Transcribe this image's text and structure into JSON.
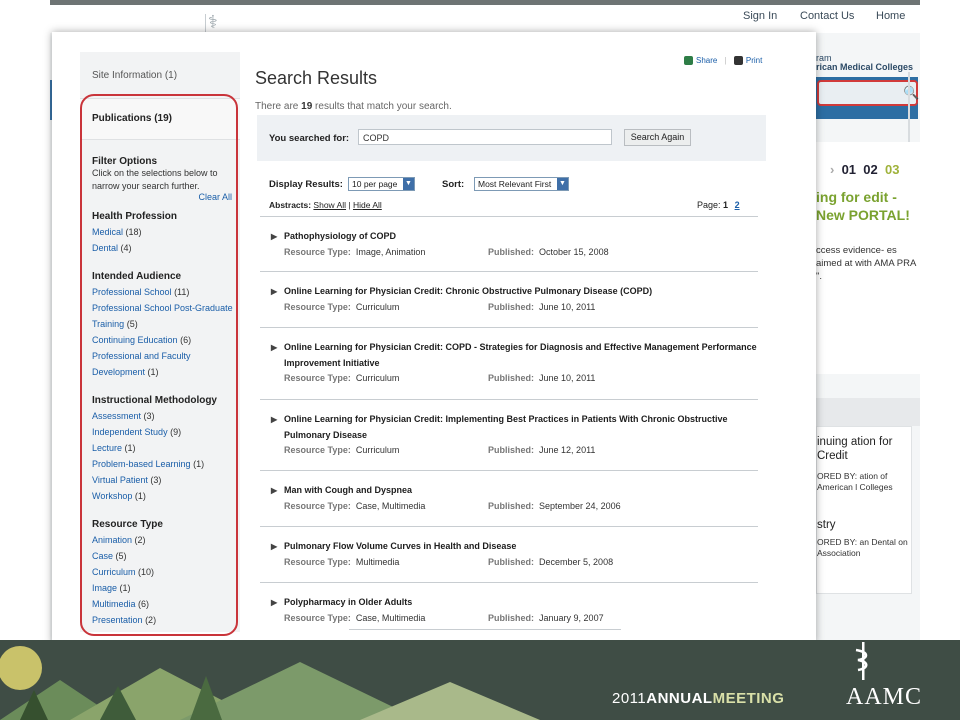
{
  "background_site": {
    "nav": {
      "signin": "Sign In",
      "contact": "Contact Us",
      "home": "Home"
    },
    "brand_lines": [
      "ram",
      "rican Medical Colleges"
    ],
    "promo": {
      "pager": [
        "01",
        "02",
        "03"
      ],
      "headline": "ing for edit - New PORTAL!",
      "text": "ccess evidence- es aimed at with AMA PRA \"."
    },
    "card": {
      "item1": "inuing ation for Credit",
      "item1_sponsor": "ORED BY: ation of American l Colleges",
      "item2": "stry",
      "item2_sponsor": "ORED BY: an Dental on Association"
    }
  },
  "actions": {
    "share": "Share",
    "print": "Print"
  },
  "sidebar": {
    "site_information": "Site Information (1)",
    "publications": "Publications (19)",
    "filter_heading": "Filter Options",
    "filter_text": "Click on the selections below to narrow your search further.",
    "clear_all": "Clear All",
    "sections": [
      {
        "heading": "Health Profession",
        "items": [
          {
            "label": "Medical",
            "count": "(18)"
          },
          {
            "label": "Dental",
            "count": "(4)"
          }
        ]
      },
      {
        "heading": "Intended Audience",
        "items": [
          {
            "label": "Professional School",
            "count": "(11)"
          },
          {
            "label": "Professional School Post-Graduate",
            "count": ""
          },
          {
            "label": "Training",
            "count": "(5)"
          },
          {
            "label": "Continuing Education",
            "count": "(6)"
          },
          {
            "label": "Professional and Faculty",
            "count": ""
          },
          {
            "label": "Development",
            "count": "(1)"
          }
        ]
      },
      {
        "heading": "Instructional Methodology",
        "items": [
          {
            "label": "Assessment",
            "count": "(3)"
          },
          {
            "label": "Independent Study",
            "count": "(9)"
          },
          {
            "label": "Lecture",
            "count": "(1)"
          },
          {
            "label": "Problem-based Learning",
            "count": "(1)"
          },
          {
            "label": "Virtual Patient",
            "count": "(3)"
          },
          {
            "label": "Workshop",
            "count": "(1)"
          }
        ]
      },
      {
        "heading": "Resource Type",
        "items": [
          {
            "label": "Animation",
            "count": "(2)"
          },
          {
            "label": "Case",
            "count": "(5)"
          },
          {
            "label": "Curriculum",
            "count": "(10)"
          },
          {
            "label": "Image",
            "count": "(1)"
          },
          {
            "label": "Multimedia",
            "count": "(6)"
          },
          {
            "label": "Presentation",
            "count": "(2)"
          }
        ]
      }
    ]
  },
  "main": {
    "title": "Search Results",
    "count_prefix": "There are",
    "count": "19",
    "count_suffix": "results that match your search.",
    "search": {
      "label": "You searched for:",
      "value": "COPD",
      "button": "Search Again"
    },
    "display_label": "Display Results:",
    "display_value": "10 per page",
    "sort_label": "Sort:",
    "sort_value": "Most Relevant First",
    "abstracts_label": "Abstracts:",
    "show_all": "Show All",
    "hide_all": "Hide All",
    "page_label": "Page:",
    "page_current": "1",
    "page_next": "2",
    "type_label": "Resource Type:",
    "published_label": "Published:",
    "results": [
      {
        "title": "Pathophysiology of COPD",
        "type": "Image, Animation",
        "published": "October 15, 2008"
      },
      {
        "title": "Online Learning for Physician Credit: Chronic Obstructive Pulmonary Disease (COPD)",
        "type": "Curriculum",
        "published": "June 10, 2011"
      },
      {
        "title": "Online Learning for Physician Credit: COPD - Strategies for Diagnosis and Effective Management Performance Improvement Initiative",
        "type": "Curriculum",
        "published": "June 10, 2011"
      },
      {
        "title": "Online Learning for Physician Credit: Implementing Best Practices in Patients With Chronic Obstructive Pulmonary Disease",
        "type": "Curriculum",
        "published": "June 12, 2011"
      },
      {
        "title": "Man with Cough and Dyspnea",
        "type": "Case, Multimedia",
        "published": "September 24, 2006"
      },
      {
        "title": "Pulmonary Flow Volume Curves in Health and Disease",
        "type": "Multimedia",
        "published": "December 5, 2008"
      },
      {
        "title": "Polypharmacy in Older Adults",
        "type": "Case, Multimedia",
        "published": "January 9, 2007"
      }
    ]
  },
  "footer": {
    "year": "2011",
    "annual": "ANNUAL",
    "meeting": "MEETING",
    "org": "AAMC"
  },
  "colors": {
    "accent_red": "#c9343a",
    "link_blue": "#1a5ea8",
    "footer_bg": "#3f4d45"
  }
}
